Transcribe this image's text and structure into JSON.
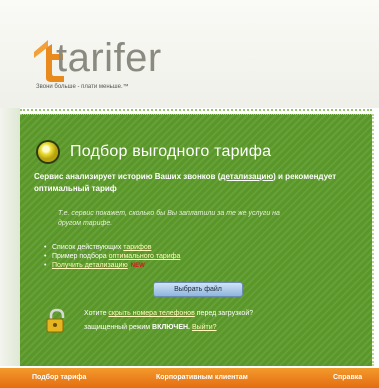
{
  "logo": {
    "wordmark": "tarifer",
    "tagline": "Звони больше - плати меньше.™"
  },
  "panel": {
    "title": "Подбор выгодного тарифа",
    "description_part1": "Сервис анализирует историю Ваших звонков (",
    "description_link": "детализацию",
    "description_part2": ") и рекомендует оптимальный тариф",
    "note": "Т.е. сервис покажет, сколько бы Вы заплатили за те же услуги на другом тарифе.",
    "links": [
      {
        "prefix": "Список действующих ",
        "link": "тарифов",
        "badge": ""
      },
      {
        "prefix": "Пример подбора ",
        "link": "оптимального тарифа",
        "badge": ""
      },
      {
        "prefix": "",
        "link": "Получить детализацию",
        "badge": "NEW"
      }
    ],
    "choose_file_button": "Выбрать файл",
    "privacy_line1_prefix": "Хотите ",
    "privacy_line1_link": "скрыть номера телефонов",
    "privacy_line1_suffix": " перед загрузкой?",
    "privacy_line2_prefix": "защищенный режим ",
    "privacy_line2_mode": "ВКЛЮЧЕН.",
    "privacy_line2_link": "Выйти?"
  },
  "nav": {
    "items": [
      "Подбор тарифа",
      "Корпоративным клиентам",
      "Справка"
    ]
  },
  "colors": {
    "panel_green": "#5e9c2c",
    "nav_orange": "#ec8420",
    "logo_orange": "#e98a1f",
    "logo_gray": "#8a8a80"
  },
  "icons": {
    "bulb": "lightbulb-icon",
    "lock": "padlock-icon"
  }
}
